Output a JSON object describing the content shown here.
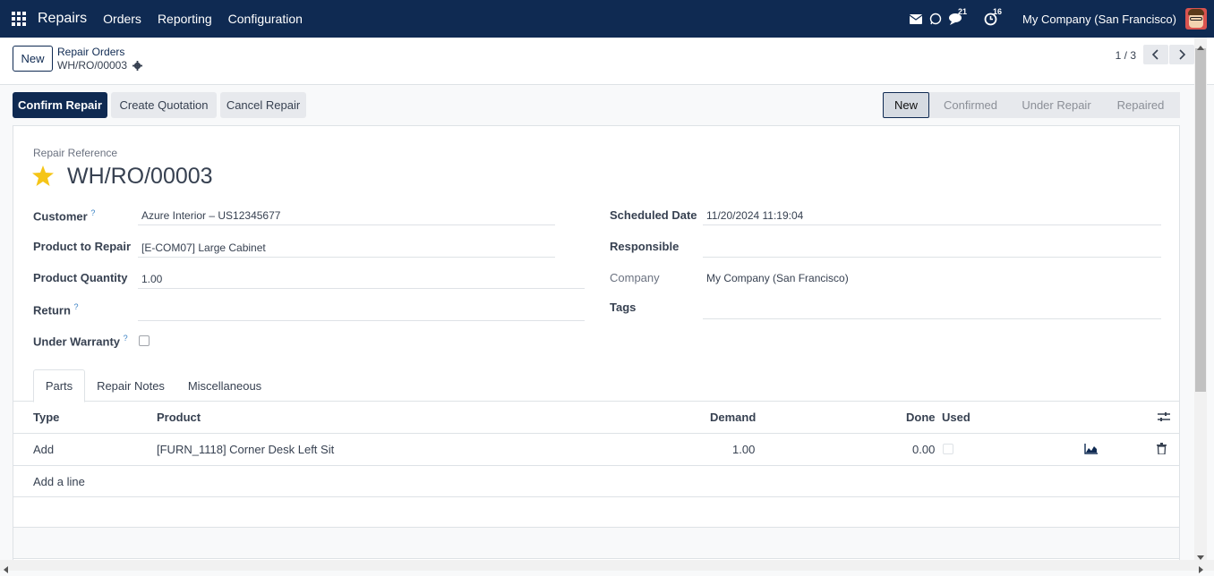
{
  "nav": {
    "brand": "Repairs",
    "menu": [
      "Orders",
      "Reporting",
      "Configuration"
    ],
    "chat_count": "21",
    "activity_count": "16",
    "company": "My Company (San Francisco)"
  },
  "control": {
    "new_label": "New",
    "breadcrumb_parent": "Repair Orders",
    "breadcrumb_current": "WH/RO/00003",
    "pager": "1 / 3"
  },
  "actions": {
    "confirm": "Confirm Repair",
    "quotation": "Create Quotation",
    "cancel": "Cancel Repair"
  },
  "status": {
    "stages": [
      "New",
      "Confirmed",
      "Under Repair",
      "Repaired"
    ],
    "active": "New"
  },
  "form": {
    "ref_label": "Repair Reference",
    "ref_value": "WH/RO/00003",
    "customer_label": "Customer",
    "customer_value": "Azure Interior – US12345677",
    "product_label": "Product to Repair",
    "product_value": "[E-COM07] Large Cabinet",
    "qty_label": "Product Quantity",
    "qty_value": "1.00",
    "return_label": "Return",
    "return_value": "",
    "warranty_label": "Under Warranty",
    "help_mark": "?",
    "scheduled_label": "Scheduled Date",
    "scheduled_value": "11/20/2024 11:19:04",
    "responsible_label": "Responsible",
    "responsible_value": "",
    "company_label": "Company",
    "company_value": "My Company (San Francisco)",
    "tags_label": "Tags",
    "tags_value": ""
  },
  "tabs": [
    "Parts",
    "Repair Notes",
    "Miscellaneous"
  ],
  "parts": {
    "columns": [
      "Type",
      "Product",
      "Demand",
      "Done",
      "Used"
    ],
    "rows": [
      {
        "type": "Add",
        "product": "[FURN_1118] Corner Desk Left Sit",
        "demand": "1.00",
        "done": "0.00",
        "used": false
      }
    ],
    "add_line": "Add a line"
  },
  "colors": {
    "nav_bg": "#0f2a52",
    "primary": "#0f2a52",
    "star": "#f5c518"
  }
}
